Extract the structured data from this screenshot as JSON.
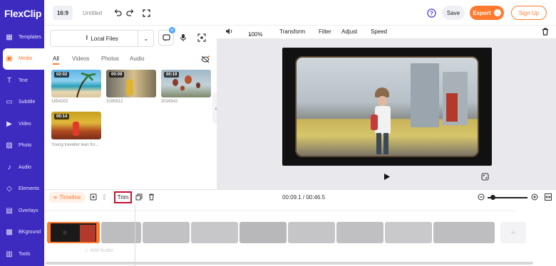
{
  "app": {
    "logo_a": "Flex",
    "logo_b": "Clip"
  },
  "sidebar": {
    "items": [
      {
        "label": "Templates",
        "icon": "templates-icon"
      },
      {
        "label": "Media",
        "icon": "media-icon",
        "active": true
      },
      {
        "label": "Text",
        "icon": "text-icon"
      },
      {
        "label": "Subtitle",
        "icon": "subtitle-icon"
      },
      {
        "label": "Video",
        "icon": "video-icon"
      },
      {
        "label": "Photo",
        "icon": "photo-icon"
      },
      {
        "label": "Audio",
        "icon": "audio-icon"
      },
      {
        "label": "Elements",
        "icon": "elements-icon"
      },
      {
        "label": "Overlays",
        "icon": "overlays-icon"
      },
      {
        "label": "BKground",
        "icon": "background-icon"
      },
      {
        "label": "Tools",
        "icon": "tools-icon"
      }
    ]
  },
  "topbar": {
    "ratio": "16:9",
    "title": "Untitled",
    "save": "Save",
    "export": "Export",
    "signup": "Sign Up"
  },
  "media": {
    "local_files": "Local Files",
    "badge": "M",
    "tabs": [
      "All",
      "Videos",
      "Photos",
      "Audio"
    ],
    "items": [
      {
        "duration": "02:02",
        "caption": "1854202"
      },
      {
        "duration": "00:09",
        "caption": "3195812"
      },
      {
        "duration": "00:19",
        "caption": "3016542"
      },
      {
        "duration": "00:14",
        "caption": "Young traveller lean fro..."
      }
    ]
  },
  "preview_toolbar": {
    "zoom": "100%",
    "transform": "Transform",
    "filter": "Filter",
    "adjust": "Adjust",
    "speed": "Speed"
  },
  "timeline": {
    "label": "Timeline",
    "trim": "Trim",
    "time": "00:09.1 / 00:46.5",
    "add_audio": "Add Audio"
  },
  "colors": {
    "sidebar": "#3d2bc0",
    "accent": "#ff7a2e",
    "trim_highlight": "#c8102e"
  }
}
